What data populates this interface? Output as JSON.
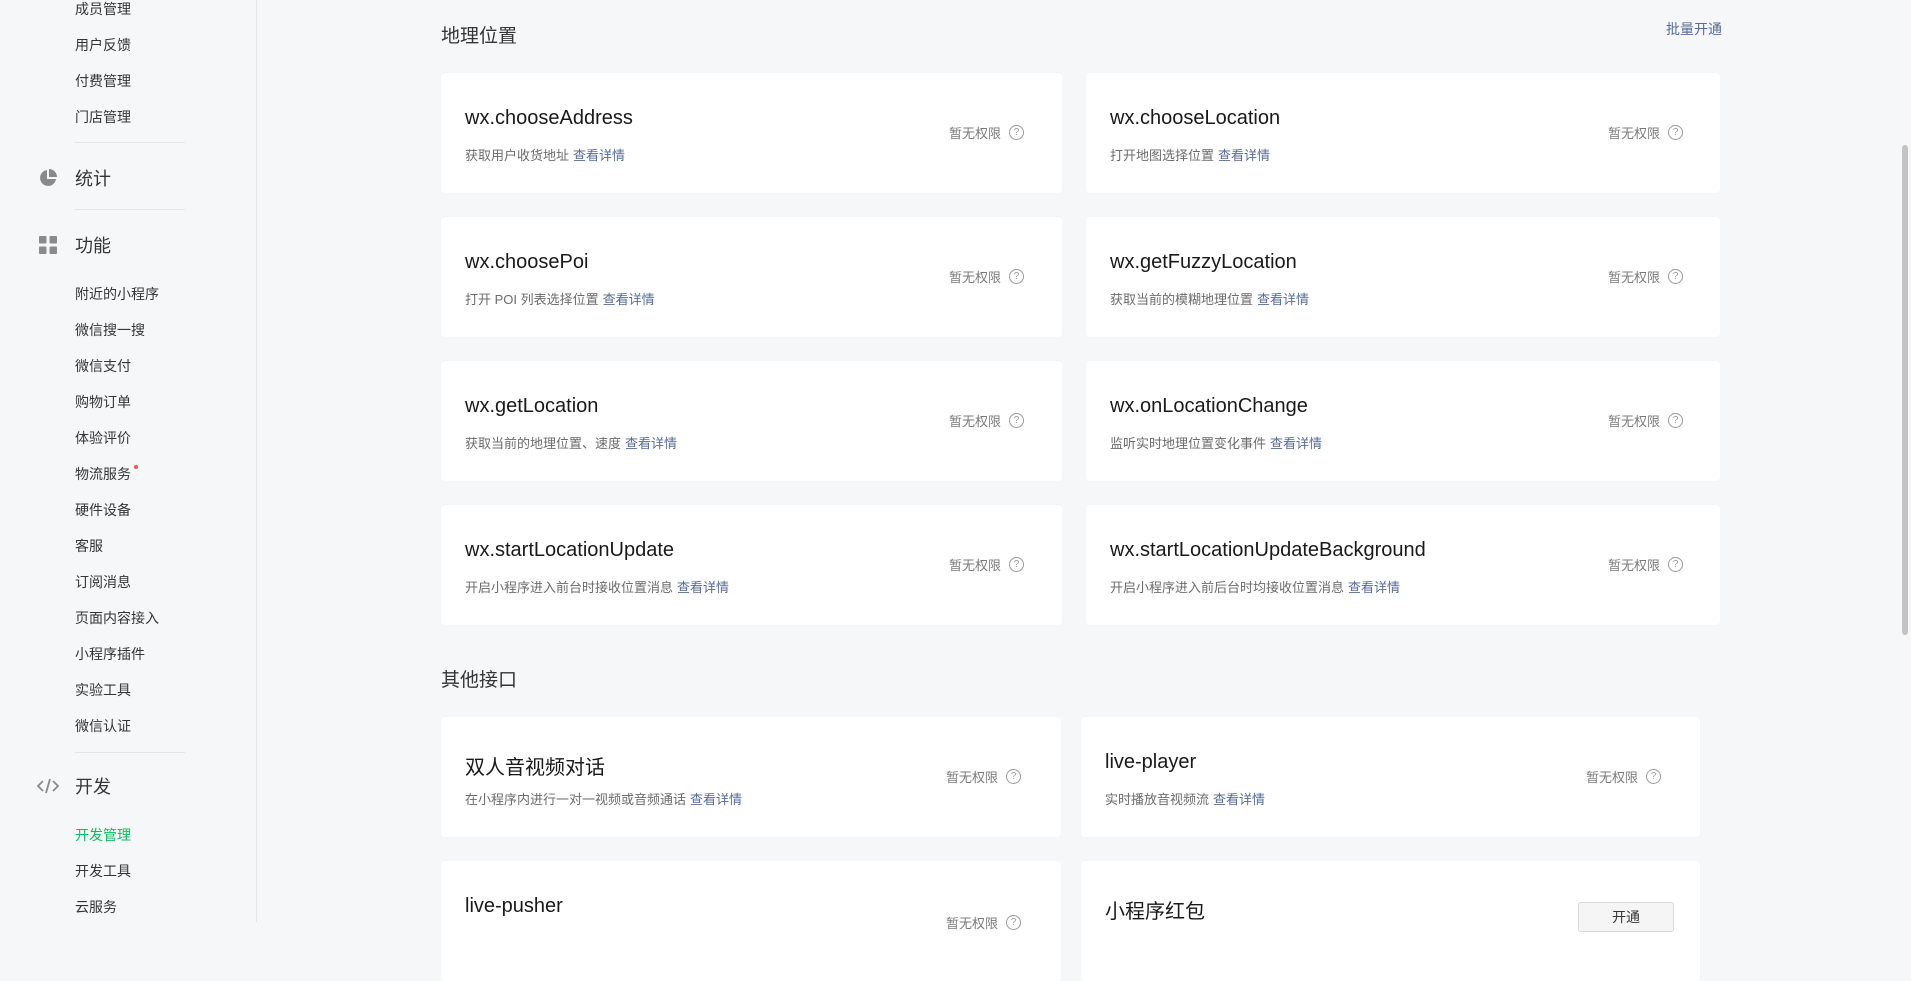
{
  "sidebar": {
    "top_items": [
      "成员管理",
      "用户反馈",
      "付费管理",
      "门店管理"
    ],
    "stats_label": "统计",
    "features_label": "功能",
    "feature_items": [
      "附近的小程序",
      "微信搜一搜",
      "微信支付",
      "购物订单",
      "体验评价",
      "物流服务",
      "硬件设备",
      "客服",
      "订阅消息",
      "页面内容接入",
      "小程序插件",
      "实验工具",
      "微信认证"
    ],
    "dev_label": "开发",
    "dev_items": [
      "开发管理",
      "开发工具",
      "云服务"
    ]
  },
  "geo": {
    "title": "地理位置",
    "batch_open": "批量开通",
    "cards": [
      {
        "title": "wx.chooseAddress",
        "desc": "获取用户收货地址",
        "more": "查看详情",
        "status": "暂无权限"
      },
      {
        "title": "wx.chooseLocation",
        "desc": "打开地图选择位置",
        "more": "查看详情",
        "status": "暂无权限"
      },
      {
        "title": "wx.choosePoi",
        "desc": "打开 POI 列表选择位置",
        "more": "查看详情",
        "status": "暂无权限"
      },
      {
        "title": "wx.getFuzzyLocation",
        "desc": "获取当前的模糊地理位置",
        "more": "查看详情",
        "status": "暂无权限"
      },
      {
        "title": "wx.getLocation",
        "desc": "获取当前的地理位置、速度",
        "more": "查看详情",
        "status": "暂无权限"
      },
      {
        "title": "wx.onLocationChange",
        "desc": "监听实时地理位置变化事件",
        "more": "查看详情",
        "status": "暂无权限"
      },
      {
        "title": "wx.startLocationUpdate",
        "desc": "开启小程序进入前台时接收位置消息",
        "more": "查看详情",
        "status": "暂无权限"
      },
      {
        "title": "wx.startLocationUpdateBackground",
        "desc": "开启小程序进入前后台时均接收位置消息",
        "more": "查看详情",
        "status": "暂无权限"
      }
    ]
  },
  "other": {
    "title": "其他接口",
    "cards": [
      {
        "title": "双人音视频对话",
        "desc": "在小程序内进行一对一视频或音频通话",
        "more": "查看详情",
        "status": "暂无权限"
      },
      {
        "title": "live-player",
        "desc": "实时播放音视频流",
        "more": "查看详情",
        "status": "暂无权限"
      },
      {
        "title": "live-pusher",
        "status": "暂无权限"
      },
      {
        "title": "小程序红包",
        "button": "开通"
      }
    ]
  },
  "help_glyph": "?",
  "icons": {
    "stats": "pie-chart-icon",
    "features": "grid-icon",
    "dev": "code-icon",
    "help": "question-circle-icon"
  },
  "colors": {
    "active": "#07c160",
    "link": "#576b95",
    "badge": "#fa5151"
  }
}
